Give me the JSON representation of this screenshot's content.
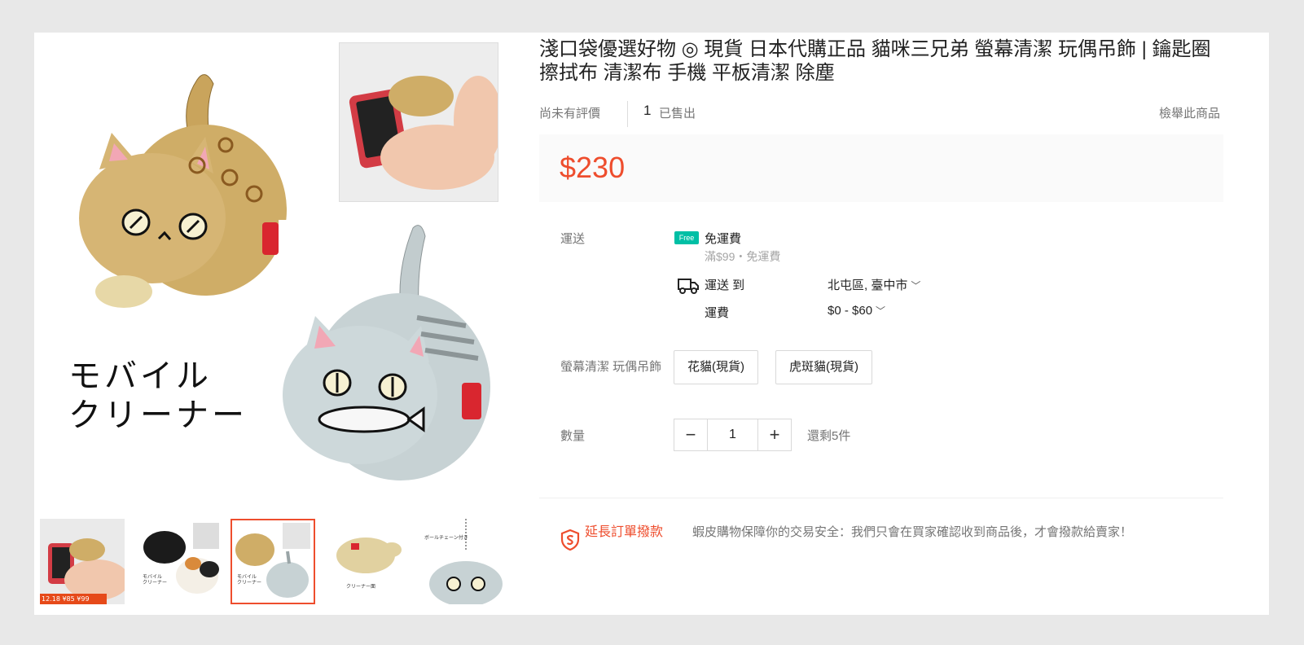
{
  "product": {
    "title": "淺口袋優選好物 ◎ 現貨 日本代購正品 貓咪三兄弟 螢幕清潔 玩偶吊飾 | 鑰匙圈 擦拭布 清潔布 手機 平板清潔 除塵",
    "rating_text": "尚未有評價",
    "sold_count": "1",
    "sold_label": "已售出",
    "report_link": "檢舉此商品",
    "price": "$230"
  },
  "gallery": {
    "main_caption": "モバイル\nクリーナー",
    "thumbnails": [
      {
        "caption": "12.18 ¥85 ¥99",
        "active": false
      },
      {
        "mini_text": "モバイル\nクリーナー",
        "active": false
      },
      {
        "mini_text": "モバイル\nクリーナー",
        "active": true
      },
      {
        "mini_text": "クリーナー面",
        "active": false
      },
      {
        "mini_text": "ボールチェーン付き",
        "active": false
      }
    ]
  },
  "shipping": {
    "label": "運送",
    "free_badge": "Free",
    "free_title": "免運費",
    "free_sub": "滿$99・免運費",
    "ship_to_label": "運送 到",
    "ship_to_value": "北屯區, 臺中市",
    "fee_label": "運費",
    "fee_value": "$0 - $60"
  },
  "variant": {
    "label": "螢幕清潔 玩偶吊飾",
    "options": [
      "花貓(現貨)",
      "虎斑貓(現貨)"
    ]
  },
  "quantity": {
    "label": "數量",
    "minus": "−",
    "value": "1",
    "plus": "+",
    "stock_text": "還剩5件"
  },
  "guarantee": {
    "title": "延長訂單撥款",
    "description": "蝦皮購物保障你的交易安全：我們只會在買家確認收到商品後，才會撥款給賣家！"
  },
  "colors": {
    "accent": "#ee4d2d",
    "teal": "#00bfa5",
    "tabby_tan": "#cfad67",
    "tabby_gray": "#c7d2d4"
  }
}
